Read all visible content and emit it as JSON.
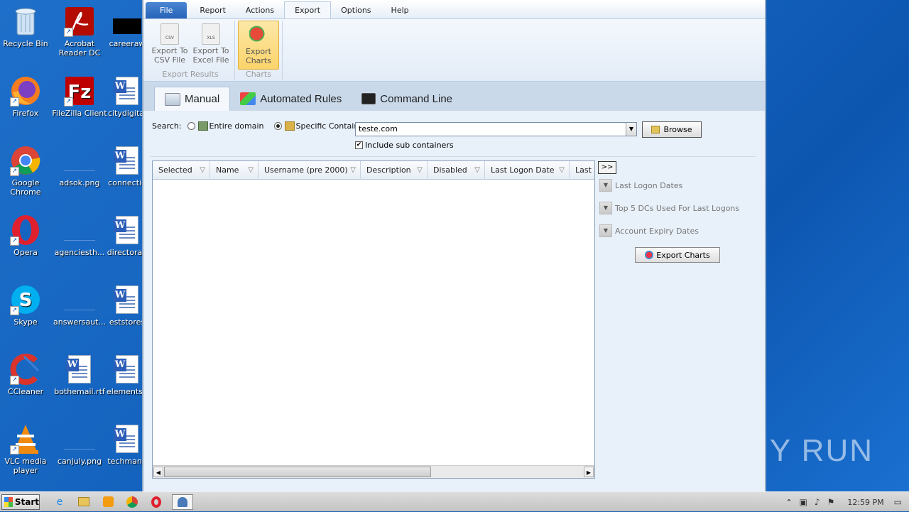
{
  "desktop": {
    "icons": [
      {
        "label": "Recycle Bin"
      },
      {
        "label": "Acrobat Reader DC"
      },
      {
        "label": "careeraw"
      },
      {
        "label": "Firefox"
      },
      {
        "label": "FileZilla Client"
      },
      {
        "label": "citydigital"
      },
      {
        "label": "Google Chrome"
      },
      {
        "label": "adsok.png"
      },
      {
        "label": "connectio"
      },
      {
        "label": "Opera"
      },
      {
        "label": "agenciesth..."
      },
      {
        "label": "directoran"
      },
      {
        "label": "Skype"
      },
      {
        "label": "answersaut..."
      },
      {
        "label": "eststores"
      },
      {
        "label": "CCleaner"
      },
      {
        "label": "bothemail.rtf"
      },
      {
        "label": "elementsp"
      },
      {
        "label": "VLC media player"
      },
      {
        "label": "canjuly.png"
      },
      {
        "label": "techmana"
      }
    ],
    "watermark": "ANY RUN"
  },
  "menubar": {
    "file": "File",
    "report": "Report",
    "actions": "Actions",
    "export": "Export",
    "options": "Options",
    "help": "Help"
  },
  "ribbon": {
    "export_csv": "Export To CSV File",
    "export_excel": "Export To Excel File",
    "export_charts": "Export Charts",
    "csv_badge": "CSV",
    "xls_badge": "XLS",
    "group_results": "Export Results",
    "group_charts": "Charts"
  },
  "tabs": {
    "manual": "Manual",
    "automated": "Automated Rules",
    "cmdline": "Command Line"
  },
  "search": {
    "label": "Search:",
    "entire_domain": "Entire domain",
    "specific_container": "Specific Container:",
    "container_value": "teste.com",
    "browse": "Browse",
    "include_sub": "Include sub containers",
    "include_sub_checked": true
  },
  "grid": {
    "columns": [
      "Selected",
      "Name",
      "Username (pre 2000)",
      "Description",
      "Disabled",
      "Last Logon Date",
      "Last L"
    ],
    "rows": []
  },
  "side": {
    "expand": ">>",
    "items": [
      "Last Logon Dates",
      "Top 5 DCs Used For Last Logons",
      "Account Expiry Dates"
    ],
    "export_charts": "Export Charts"
  },
  "taskbar": {
    "start": "Start",
    "time": "12:59 PM"
  }
}
